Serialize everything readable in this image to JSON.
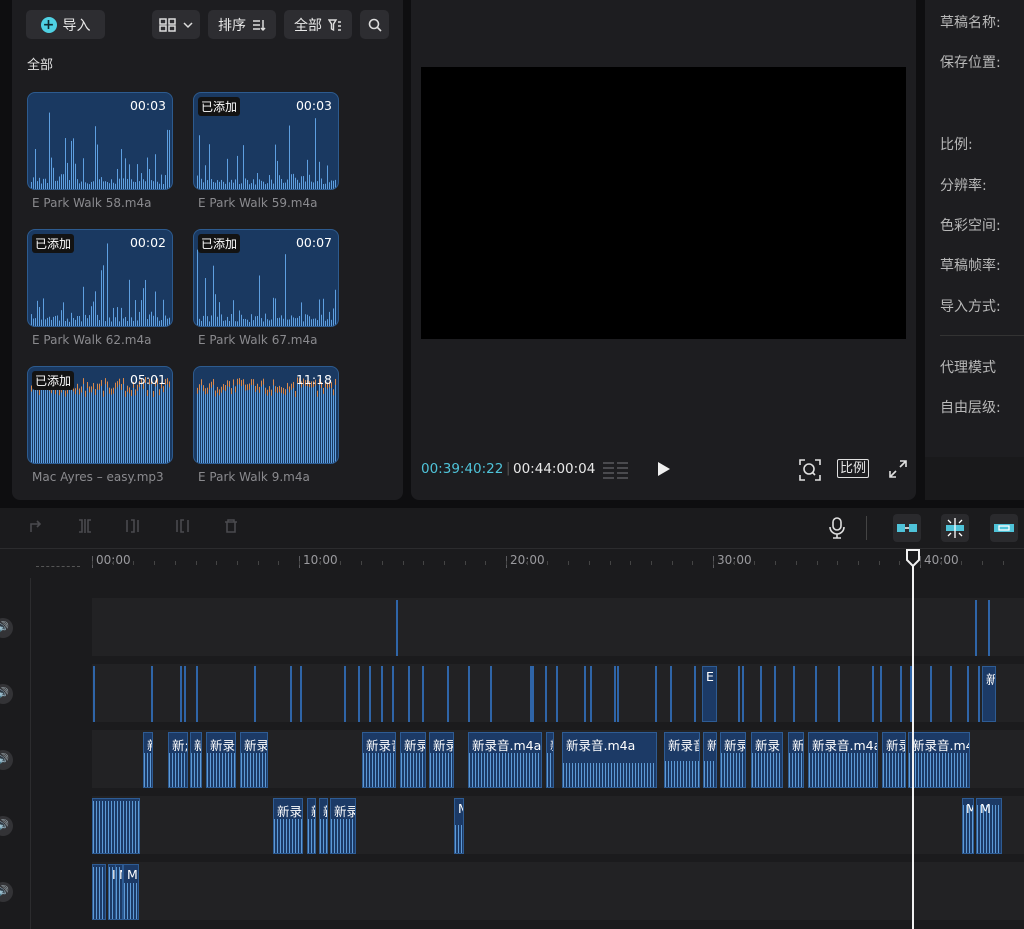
{
  "media": {
    "import_label": "导入",
    "sort_label": "排序",
    "filter_label": "全部",
    "section_label": "全部",
    "items": [
      {
        "name": "E Park Walk 58.m4a",
        "duration": "00:03",
        "badge": ""
      },
      {
        "name": "E Park Walk 59.m4a",
        "duration": "00:03",
        "badge": "已添加"
      },
      {
        "name": "E Park Walk 62.m4a",
        "duration": "00:02",
        "badge": "已添加"
      },
      {
        "name": "E Park Walk 67.m4a",
        "duration": "00:07",
        "badge": "已添加"
      },
      {
        "name": "Mac Ayres – easy.mp3",
        "duration": "05:01",
        "badge": "已添加"
      },
      {
        "name": "E Park Walk 9.m4a",
        "duration": "11:18",
        "badge": ""
      }
    ]
  },
  "player": {
    "current_time": "00:39:40:22",
    "total_time": "00:44:00:04",
    "ratio_label": "比例",
    "accent": "#4fc3d9"
  },
  "properties": {
    "labels": [
      "草稿名称:",
      "保存位置:",
      "比例:",
      "分辨率:",
      "色彩空间:",
      "草稿帧率:",
      "导入方式:",
      "代理模式",
      "自由层级:"
    ]
  },
  "timeline": {
    "ruler": [
      "00:00",
      "10:00",
      "20:00",
      "30:00",
      "40:00"
    ],
    "tracks": [
      {
        "clips": []
      },
      {
        "clips": [
          {
            "label": "E"
          },
          {
            "label": "新"
          }
        ]
      },
      {
        "clips": [
          {
            "label": "新"
          },
          {
            "label": "新;"
          },
          {
            "label": "新"
          },
          {
            "label": "新录"
          },
          {
            "label": "新录"
          },
          {
            "label": "新录音"
          },
          {
            "label": "新录"
          },
          {
            "label": "新录"
          },
          {
            "label": "新录音.m4a"
          },
          {
            "label": "新"
          },
          {
            "label": "新录音.m4a"
          },
          {
            "label": "新录音"
          },
          {
            "label": "新"
          },
          {
            "label": "新录"
          },
          {
            "label": "新录"
          },
          {
            "label": "新"
          },
          {
            "label": "新录音.m4a"
          },
          {
            "label": "新录"
          },
          {
            "label": "新录音.m4a"
          }
        ]
      },
      {
        "clips": [
          {
            "label": "新"
          },
          {
            "label": "新录"
          },
          {
            "label": "新"
          },
          {
            "label": "新"
          },
          {
            "label": "新录"
          },
          {
            "label": "M"
          },
          {
            "label": "M"
          },
          {
            "label": "M"
          }
        ]
      },
      {
        "clips": [
          {
            "label": "I"
          },
          {
            "label": "N"
          },
          {
            "label": "Ma"
          }
        ]
      }
    ]
  }
}
